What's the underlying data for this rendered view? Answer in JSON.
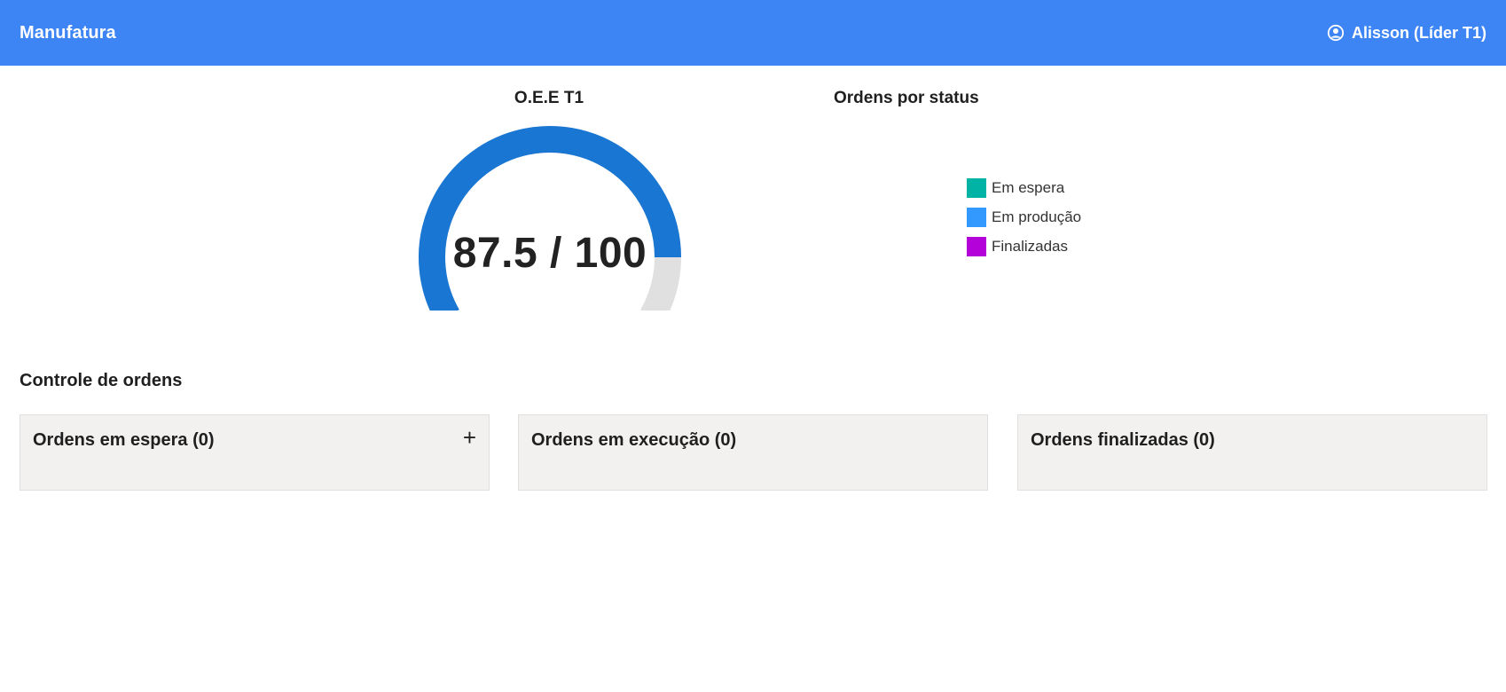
{
  "header": {
    "app_title": "Manufatura",
    "user_label": "Alisson (Líder T1)",
    "user_icon": "user-circle-icon",
    "background_color": "#3d84f5"
  },
  "oee": {
    "title": "O.E.E T1",
    "value_text": "87.5 / 100",
    "value": 87.5,
    "max": 100,
    "fill_color": "#1976d2",
    "track_color": "#e0e0e0"
  },
  "orders_by_status": {
    "title": "Ordens por status",
    "legend": [
      {
        "label": "Em espera",
        "color": "#00b3a4"
      },
      {
        "label": "Em produção",
        "color": "#3399ff"
      },
      {
        "label": "Finalizadas",
        "color": "#b400d9"
      }
    ]
  },
  "order_control": {
    "title": "Controle de ordens",
    "cards": [
      {
        "title": "Ordens em espera (0)",
        "add_label": "+"
      },
      {
        "title": "Ordens em execução (0)"
      },
      {
        "title": "Ordens finalizadas (0)"
      }
    ]
  }
}
